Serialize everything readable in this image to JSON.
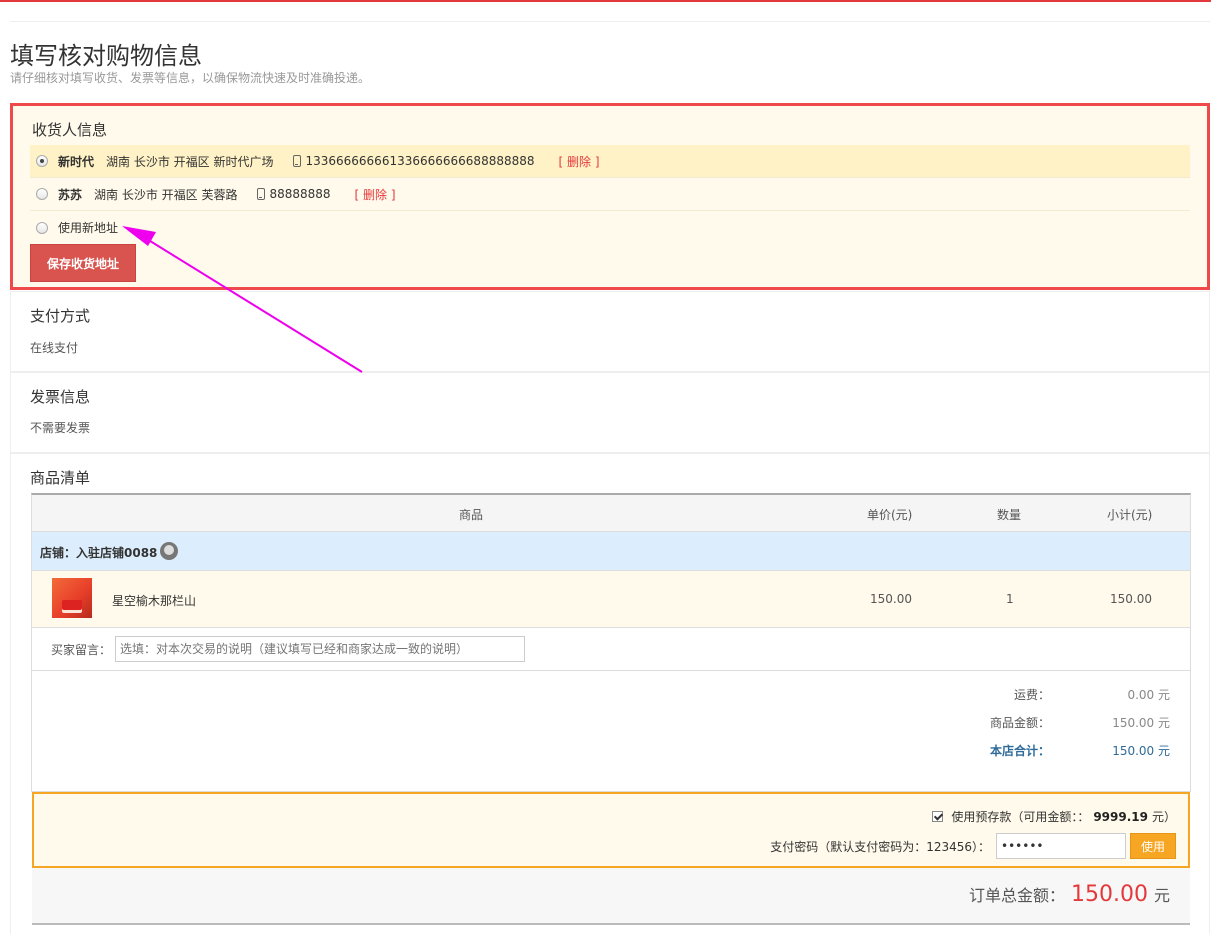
{
  "page": {
    "title": "填写核对购物信息",
    "subtitle": "请仔细核对填写收货、发票等信息，以确保物流快速及时准确投递。"
  },
  "consignee": {
    "title": "收货人信息",
    "addresses": [
      {
        "name": "新时代",
        "address": "湖南 长沙市 开福区 新时代广场",
        "phone": "133666666661336666666688888888",
        "delete": "[ 删除 ]"
      },
      {
        "name": "苏苏",
        "address": "湖南 长沙市 开福区 芙蓉路",
        "phone": "88888888",
        "delete": "[ 删除 ]"
      }
    ],
    "new_address": "使用新地址",
    "save_button": "保存收货地址"
  },
  "payment": {
    "title": "支付方式",
    "value": "在线支付"
  },
  "invoice": {
    "title": "发票信息",
    "value": "不需要发票"
  },
  "goods": {
    "title": "商品清单",
    "columns": [
      "商品",
      "单价(元)",
      "数量",
      "小计(元)"
    ],
    "store": "店铺：入驻店铺0088",
    "item": {
      "name": "星空榆木那栏山",
      "price": "150.00",
      "qty": "1",
      "subtotal": "150.00"
    },
    "message_label": "买家留言：",
    "message_placeholder": "选填：对本次交易的说明（建议填写已经和商家达成一致的说明）",
    "totals": {
      "shipping_label": "运费：",
      "shipping_value": "0.00 元",
      "goods_label": "商品金额：",
      "goods_value": "150.00 元",
      "store_label": "本店合计：",
      "store_value": "150.00 元"
    }
  },
  "deposit": {
    "use_label": "使用预存款（可用金额：：",
    "balance": "9999.19",
    "balance_suffix": "元）",
    "password_label": "支付密码（默认支付密码为：123456）：",
    "password_value": "••••••",
    "use_button": "使用"
  },
  "order_total": {
    "label": "订单总金额：",
    "value": "150.00",
    "unit": "元"
  },
  "colors": {
    "accent": "#e4393c",
    "highlight_border": "#ee4a4b",
    "deposit_border": "#f7a623",
    "annotation_arrow": "#ee00ee"
  }
}
